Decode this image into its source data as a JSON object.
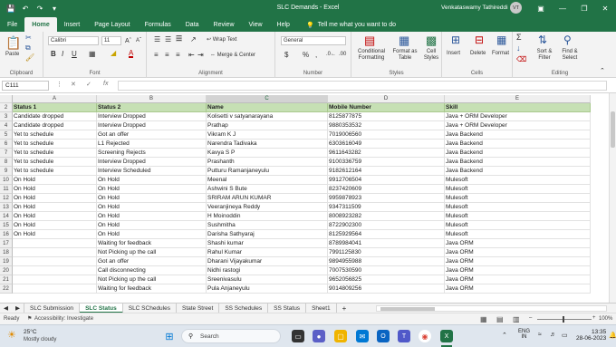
{
  "window": {
    "title": "SLC Demands  -  Excel",
    "user": "Venkataswamy Tathireddi",
    "user_initials": "VT"
  },
  "titlebar_icons": {
    "save": "save-icon",
    "undo": "undo-icon",
    "redo": "redo-icon",
    "customize": "customize-icon"
  },
  "menu": {
    "items": [
      "File",
      "Home",
      "Insert",
      "Page Layout",
      "Formulas",
      "Data",
      "Review",
      "View",
      "Help"
    ],
    "active": "Home",
    "tellme": "Tell me what you want to do"
  },
  "ribbon": {
    "clipboard": {
      "label": "Clipboard",
      "paste": "Paste"
    },
    "font": {
      "label": "Font",
      "name": "Calibri",
      "size": "11",
      "bold": "B",
      "italic": "I",
      "underline": "U"
    },
    "alignment": {
      "label": "Alignment",
      "wrap": "Wrap Text",
      "merge": "Merge & Center"
    },
    "number": {
      "label": "Number",
      "format": "General",
      "currency": "$",
      "percent": "%",
      "comma": ","
    },
    "styles": {
      "label": "Styles",
      "conditional": "Conditional",
      "conditional2": "Formatting",
      "format_table": "Format as",
      "format_table2": "Table",
      "cell_styles": "Cell",
      "cell_styles2": "Styles"
    },
    "cells": {
      "label": "Cells",
      "insert": "Insert",
      "delete": "Delete",
      "format": "Format"
    },
    "editing": {
      "label": "Editing",
      "sort": "Sort &",
      "sort2": "Filter",
      "find": "Find &",
      "find2": "Select"
    }
  },
  "formula_bar": {
    "name_box": "C111",
    "fx": "fx",
    "value": ""
  },
  "columns": [
    {
      "letter": "A"
    },
    {
      "letter": "B"
    },
    {
      "letter": "C",
      "selected": true
    },
    {
      "letter": "D"
    },
    {
      "letter": "E"
    }
  ],
  "rows": [
    {
      "n": "2",
      "cells": [
        "Status 1",
        "Status 2",
        "Name",
        "Mobile Number",
        "Skill"
      ],
      "header": true
    },
    {
      "n": "3",
      "cells": [
        "Candidate dropped",
        "Interview Dropped",
        "Kolisetti v satyanarayana",
        "8125877875",
        "Java + ORM Developer"
      ]
    },
    {
      "n": "4",
      "cells": [
        "Candidate dropped",
        "Interview Dropped",
        "Prathap",
        "9880353532",
        "Java + ORM Developer"
      ]
    },
    {
      "n": "5",
      "cells": [
        "Yet to schedule",
        "Got an offer",
        "Vikram K J",
        "7019006560",
        "Java Backend"
      ]
    },
    {
      "n": "6",
      "cells": [
        "Yet to schedule",
        "L1 Rejected",
        "Narendra Tadivaka",
        "6303616049",
        "Java Backend"
      ]
    },
    {
      "n": "7",
      "cells": [
        "Yet to schedule",
        "Screening Rejects",
        "Kavya S P",
        "9611643282",
        "Java Backend"
      ]
    },
    {
      "n": "8",
      "cells": [
        "Yet to schedule",
        "Interview Dropped",
        "Prashanth",
        "9100336759",
        "Java Backend"
      ]
    },
    {
      "n": "9",
      "cells": [
        "Yet to schedule",
        "Interview Scheduled",
        "Putturu Ramanjaneyulu",
        "9182612164",
        "Java Backend"
      ]
    },
    {
      "n": "10",
      "cells": [
        "On Hold",
        "On Hold",
        "Meenal",
        "9912706504",
        "Mulesoft"
      ]
    },
    {
      "n": "11",
      "cells": [
        "On Hold",
        "On Hold",
        "Ashwini S Bute",
        "8237420609",
        "Mulesoft"
      ]
    },
    {
      "n": "12",
      "cells": [
        "On Hold",
        "On Hold",
        "SRIRAM ARUN KUMAR",
        "9959878923",
        "Mulesoft"
      ]
    },
    {
      "n": "13",
      "cells": [
        "On Hold",
        "On Hold",
        "Veeranjineya Reddy",
        "9347311509",
        "Mulesoft"
      ]
    },
    {
      "n": "14",
      "cells": [
        "On Hold",
        "On Hold",
        "H Moinoddin",
        "8008923282",
        "Mulesoft"
      ]
    },
    {
      "n": "15",
      "cells": [
        "On Hold",
        "On Hold",
        "Sushmitha",
        "8722902300",
        "Mulesoft"
      ]
    },
    {
      "n": "16",
      "cells": [
        "On Hold",
        "On Hold",
        "Darisha Sathyaraj",
        "8125929564",
        "Mulesoft"
      ]
    },
    {
      "n": "17",
      "cells": [
        "",
        "Waiting for feedback",
        "Shashi kumar",
        "8789984041",
        "Java ORM"
      ]
    },
    {
      "n": "18",
      "cells": [
        "",
        "Not Picking up the call",
        "Rahul Kumar",
        "7991125830",
        "Java ORM"
      ]
    },
    {
      "n": "19",
      "cells": [
        "",
        "Got an offer",
        "Dharani Vijayakumar",
        "9894955988",
        "Java ORM"
      ]
    },
    {
      "n": "20",
      "cells": [
        "",
        "Call disconnecting",
        "Nidhi rastogi",
        "7007530590",
        "Java ORM"
      ]
    },
    {
      "n": "21",
      "cells": [
        "",
        "Not Picking up the call",
        "Sreenivasulu",
        "9652056825",
        "Java ORM"
      ]
    },
    {
      "n": "22",
      "cells": [
        "",
        "Waiting for feedback",
        "Pula Anjaneyulu",
        "9014809256",
        "Java ORM"
      ]
    }
  ],
  "sheets": {
    "items": [
      "SLC Submission",
      "SLC Status",
      "SLC SChedules",
      "State Street",
      "SS Schedules",
      "SS Status",
      "Sheet1"
    ],
    "active": "SLC Status",
    "add": "+"
  },
  "status": {
    "ready": "Ready",
    "accessibility": "Accessibility: Investigate",
    "zoom": "100%"
  },
  "taskbar": {
    "weather_temp": "25°C",
    "weather_desc": "Mostly cloudy",
    "search": "Search",
    "lang1": "ENG",
    "lang2": "IN",
    "time": "13:35",
    "date": "28-06-2023"
  },
  "colors": {
    "excel_green": "#217346",
    "header_fill": "#c6e0b4"
  }
}
